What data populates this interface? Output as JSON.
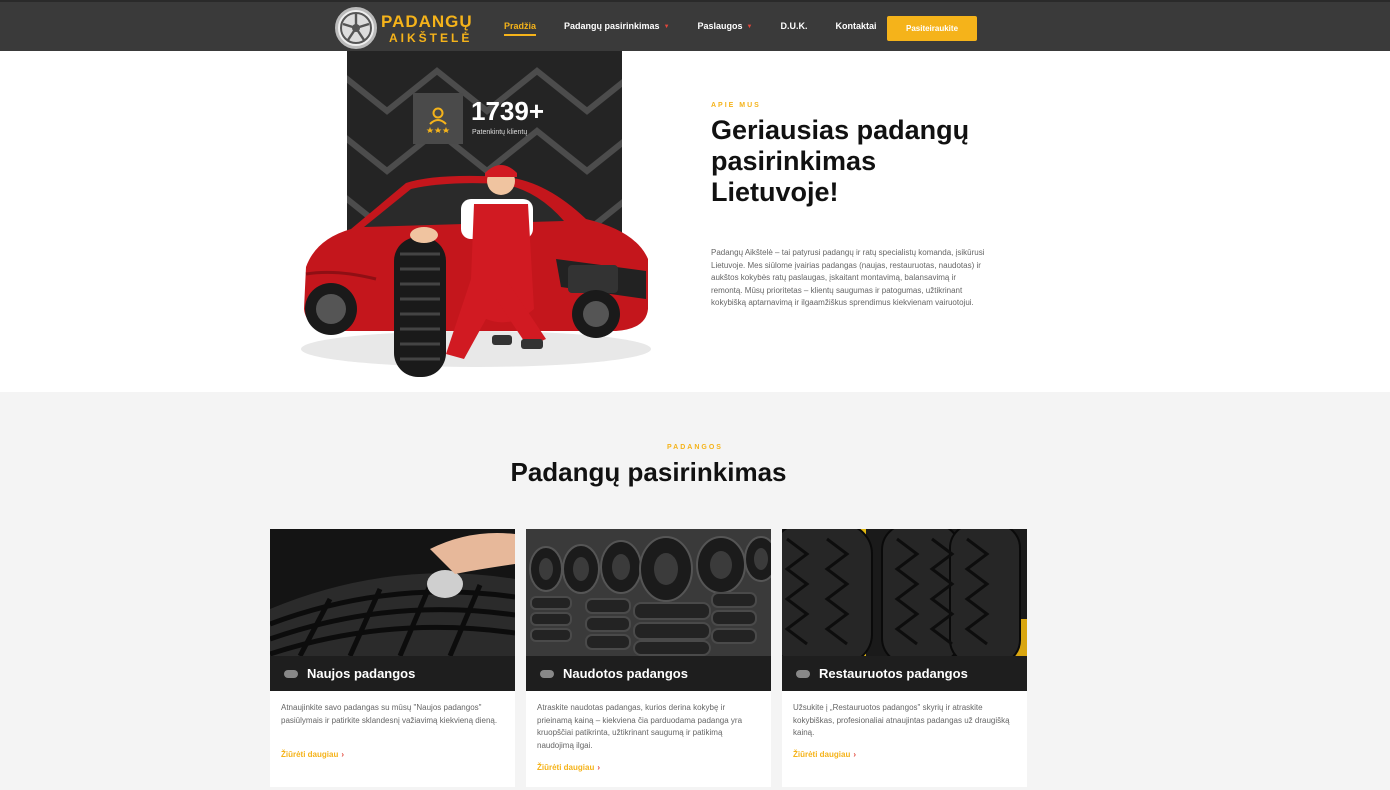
{
  "nav": {
    "logo": {
      "line1": "PADANGŲ",
      "line2": "AIKŠTELĖ"
    },
    "items": [
      {
        "label": "Pradžia",
        "active": true,
        "dropdown": false
      },
      {
        "label": "Padangų pasirinkimas",
        "active": false,
        "dropdown": true
      },
      {
        "label": "Paslaugos",
        "active": false,
        "dropdown": true
      },
      {
        "label": "D.U.K.",
        "active": false,
        "dropdown": false
      },
      {
        "label": "Kontaktai",
        "active": false,
        "dropdown": false
      }
    ],
    "cta_label": "Pasiteiraukite"
  },
  "hero": {
    "stat_number": "1739+",
    "stat_label": "Patenkintų klientų",
    "eyebrow": "APIE MUS",
    "title": "Geriausias padangų pasirinkimas Lietuvoje!",
    "description": "Padangų Aikštelė – tai patyrusi padangų ir ratų specialistų komanda, įsikūrusi Lietuvoje. Mes siūlome įvairias padangas (naujas, restauruotas, naudotas) ir aukštos kokybės ratų paslaugas, įskaitant montavimą, balansavimą ir remontą. Mūsų prioritetas – klientų saugumas ir patogumas, užtikrinant kokybišką aptarnavimą ir ilgaamžiškus sprendimus kiekvienam vairuotojui."
  },
  "section": {
    "eyebrow": "PADANGOS",
    "title": "Padangų pasirinkimas"
  },
  "cards": [
    {
      "title": "Naujos padangos",
      "description": "Atnaujinkite savo padangas su mūsų \"Naujos padangos\" pasiūlymais ir patirkite sklandesnį važiavimą kiekvieną dieną.",
      "link": "Žiūrėti daugiau"
    },
    {
      "title": "Naudotos padangos",
      "description": "Atraskite naudotas padangas, kurios derina kokybę ir prieinamą kainą – kiekviena čia parduodama padanga yra kruopščiai patikrinta, užtikrinant saugumą ir patikimą naudojimą ilgai.",
      "link": "Žiūrėti daugiau"
    },
    {
      "title": "Restauruotos padangos",
      "description": "Užsukite į „Restauruotos padangos\" skyrių ir atraskite kokybiškas, profesionaliai atnaujintas padangas už draugišką kainą.",
      "link": "Žiūrėti daugiau"
    }
  ],
  "colors": {
    "accent": "#f5b31a",
    "nav_bg": "#3a3a3a",
    "dark": "#1e1e1e",
    "caret": "#e2463a"
  },
  "icons": [
    "wheel-logo-icon",
    "customer-rating-icon",
    "tag-pill-icon",
    "chevron-right-icon",
    "dropdown-caret-icon"
  ]
}
